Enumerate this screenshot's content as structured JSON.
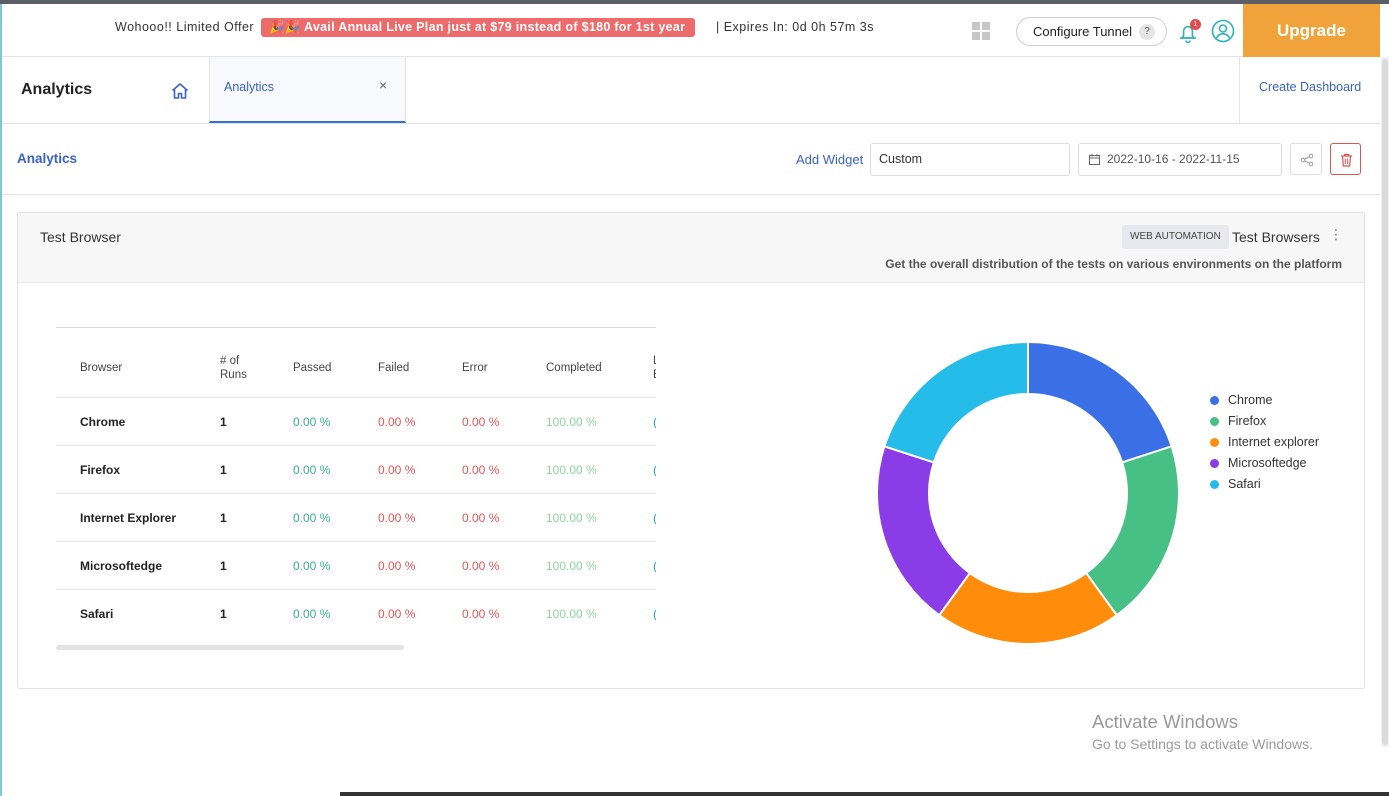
{
  "banner": {
    "offer_text": "Wohooo!! Limited Offer",
    "offer_pill": "🎉🎉 Avail Annual Live Plan just at $79 instead of $180 for 1st year",
    "expires": "| Expires In: 0d 0h 57m 3s",
    "configure_tunnel": "Configure Tunnel",
    "help_label": "?",
    "notification_count": "1",
    "upgrade_label": "Upgrade"
  },
  "header": {
    "title": "Analytics",
    "tab_label": "Analytics",
    "tab_close": "×",
    "create_dashboard": "Create Dashboard"
  },
  "toolbar": {
    "title": "Analytics",
    "add_widget": "Add Widget",
    "range_select": "Custom",
    "date_range": "2022-10-16 - 2022-11-15"
  },
  "widget": {
    "title": "Test Browser",
    "tag": "WEB AUTOMATION",
    "category": "Test Browsers",
    "menu": "⋮",
    "description": "Get the overall distribution of the tests on various environments on the platform"
  },
  "table": {
    "headers": [
      "Browser",
      "# of\nRuns",
      "Passed",
      "Failed",
      "Error",
      "Completed",
      "L\nE"
    ],
    "rows": [
      {
        "browser": "Chrome",
        "runs": "1",
        "passed": "0.00 %",
        "failed": "0.00 %",
        "error": "0.00 %",
        "completed": "100.00 %",
        "extra": "("
      },
      {
        "browser": "Firefox",
        "runs": "1",
        "passed": "0.00 %",
        "failed": "0.00 %",
        "error": "0.00 %",
        "completed": "100.00 %",
        "extra": "("
      },
      {
        "browser": "Internet Explorer",
        "runs": "1",
        "passed": "0.00 %",
        "failed": "0.00 %",
        "error": "0.00 %",
        "completed": "100.00 %",
        "extra": "("
      },
      {
        "browser": "Microsoftedge",
        "runs": "1",
        "passed": "0.00 %",
        "failed": "0.00 %",
        "error": "0.00 %",
        "completed": "100.00 %",
        "extra": "("
      },
      {
        "browser": "Safari",
        "runs": "1",
        "passed": "0.00 %",
        "failed": "0.00 %",
        "error": "0.00 %",
        "completed": "100.00 %",
        "extra": "("
      }
    ]
  },
  "chart_data": {
    "type": "pie",
    "title": "",
    "categories": [
      "Chrome",
      "Firefox",
      "Internet explorer",
      "Microsoftedge",
      "Safari"
    ],
    "values": [
      1,
      1,
      1,
      1,
      1
    ],
    "colors": [
      "#3b6fe6",
      "#46c084",
      "#ff8c0a",
      "#8a3ce6",
      "#26bce9"
    ],
    "donut": true,
    "legend_position": "right"
  },
  "watermark": {
    "line1": "Activate Windows",
    "line2": "Go to Settings to activate Windows."
  }
}
